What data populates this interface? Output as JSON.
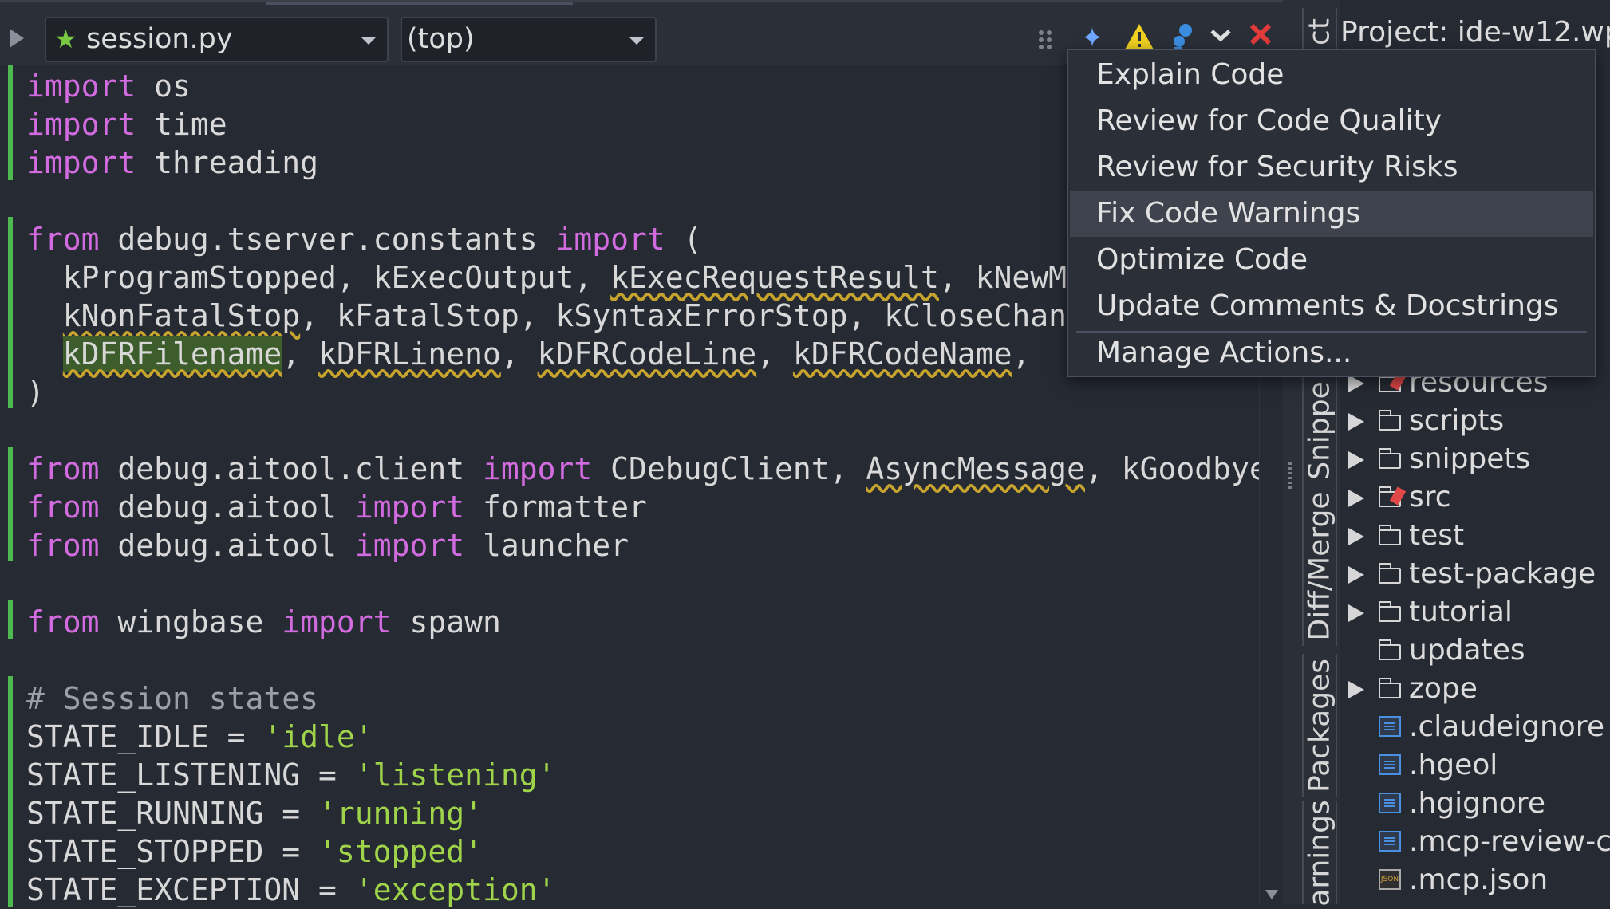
{
  "toolbar": {
    "file": "session.py",
    "scope": "(top)",
    "icons": [
      "grip-icon",
      "ai-sparkle-icon",
      "warning-icon",
      "debug-icon",
      "chevron-down-icon",
      "close-icon"
    ],
    "colors": {
      "star": "#7ac943",
      "warning": "#f0d020",
      "close": "#e23b3b",
      "sparkle": "#6fa8ff",
      "debug": "#3b8de0"
    }
  },
  "editor": {
    "lines": [
      {
        "text": "import os"
      },
      {
        "text": "import time"
      },
      {
        "text": "import threading"
      },
      {
        "text": ""
      },
      {
        "text": "from debug.tserver.constants import ("
      },
      {
        "text": "  kProgramStopped, kExecOutput, kExecRequestResult, kNewModul"
      },
      {
        "text": "  kNonFatalStop, kFatalStop, kSyntaxErrorStop, kCloseChannelS"
      },
      {
        "text": "  kDFRFilename, kDFRLineno, kDFRCodeLine, kDFRCodeName,"
      },
      {
        "text": ")"
      },
      {
        "text": ""
      },
      {
        "text": "from debug.aitool.client import CDebugClient, AsyncMessage, kGoodbye"
      },
      {
        "text": "from debug.aitool import formatter"
      },
      {
        "text": "from debug.aitool import launcher"
      },
      {
        "text": ""
      },
      {
        "text": "from wingbase import spawn"
      },
      {
        "text": ""
      },
      {
        "text": "# Session states"
      },
      {
        "text": "STATE_IDLE = 'idle'"
      },
      {
        "text": "STATE_LISTENING = 'listening'"
      },
      {
        "text": "STATE_RUNNING = 'running'"
      },
      {
        "text": "STATE_STOPPED = 'stopped'"
      },
      {
        "text": "STATE_EXCEPTION = 'exception'"
      }
    ]
  },
  "side_tabs": [
    "Snippe",
    "Diff/Merge",
    "Packages",
    "arnings"
  ],
  "side_top_tab": "ct",
  "project": {
    "title": "Project: ide-w12.wp",
    "items": [
      {
        "label": "resources",
        "type": "folder",
        "expandable": true
      },
      {
        "label": "scripts",
        "type": "folder",
        "expandable": true
      },
      {
        "label": "snippets",
        "type": "folder",
        "expandable": true
      },
      {
        "label": "src",
        "type": "folder",
        "expandable": true
      },
      {
        "label": "test",
        "type": "folder",
        "expandable": true
      },
      {
        "label": "test-package",
        "type": "folder",
        "expandable": true
      },
      {
        "label": "tutorial",
        "type": "folder",
        "expandable": true
      },
      {
        "label": "updates",
        "type": "folder",
        "expandable": false
      },
      {
        "label": "zope",
        "type": "folder",
        "expandable": true
      },
      {
        "label": ".claudeignore",
        "type": "file",
        "expandable": false
      },
      {
        "label": ".hgeol",
        "type": "file",
        "expandable": false
      },
      {
        "label": ".hgignore",
        "type": "file",
        "expandable": false
      },
      {
        "label": ".mcp-review-c",
        "type": "file",
        "expandable": false
      },
      {
        "label": ".mcp.json",
        "type": "json",
        "expandable": false
      }
    ]
  },
  "menu": {
    "items": [
      {
        "label": "Explain Code"
      },
      {
        "label": "Review for Code Quality"
      },
      {
        "label": "Review for Security Risks"
      },
      {
        "label": "Fix Code Warnings",
        "active": true
      },
      {
        "label": "Optimize Code"
      },
      {
        "label": "Update Comments & Docstrings"
      },
      {
        "label": "Manage Actions..."
      }
    ]
  }
}
